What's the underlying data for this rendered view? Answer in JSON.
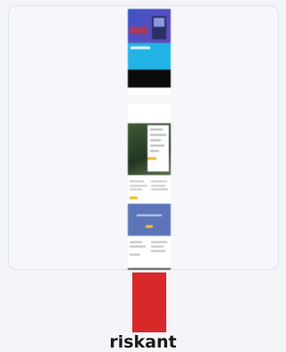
{
  "preview": {
    "icon": "website-thumbnail"
  },
  "risk": {
    "label": "riskant",
    "level": 0.75,
    "color": "#d9282a"
  }
}
